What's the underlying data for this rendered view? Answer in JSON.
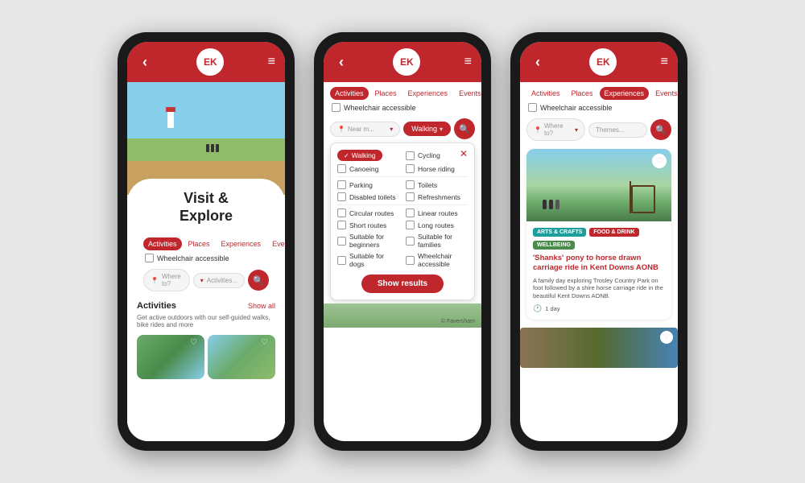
{
  "colors": {
    "primary": "#c0272d",
    "white": "#ffffff",
    "dark": "#1a1a1a",
    "gray": "#e8e8e8"
  },
  "phone1": {
    "header": {
      "logo": "EK",
      "back_icon": "‹",
      "menu_icon": "≡"
    },
    "nav_tabs": [
      {
        "label": "Activities",
        "active": true
      },
      {
        "label": "Places",
        "active": false
      },
      {
        "label": "Experiences",
        "active": false
      },
      {
        "label": "Events",
        "active": false
      }
    ],
    "wheelchair_label": "Wheelchair accessible",
    "search": {
      "placeholder": "Where to?",
      "dropdown_placeholder": "Activities..."
    },
    "hero_title": "Visit &\nExplore",
    "activities_section": {
      "title": "Activities",
      "show_all": "Show all",
      "description": "Get active outdoors with our self-guided walks, bike rides and more"
    }
  },
  "phone2": {
    "header": {
      "logo": "EK",
      "back_icon": "‹",
      "menu_icon": "≡"
    },
    "nav_tabs": [
      {
        "label": "Activities",
        "active": true
      },
      {
        "label": "Places",
        "active": false
      },
      {
        "label": "Experiences",
        "active": false
      },
      {
        "label": "Events",
        "active": false
      }
    ],
    "wheelchair_label": "Wheelchair accessible",
    "search": {
      "near_placeholder": "Near m...",
      "active_filter": "Walking"
    },
    "dropdown": {
      "filters": [
        {
          "label": "Walking",
          "checked": true
        },
        {
          "label": "Cycling",
          "checked": false
        },
        {
          "label": "Canoeing",
          "checked": false
        },
        {
          "label": "Horse riding",
          "checked": false
        }
      ],
      "amenities": [
        {
          "label": "Parking",
          "checked": false
        },
        {
          "label": "Toilets",
          "checked": false
        },
        {
          "label": "Disabled toilets",
          "checked": false
        },
        {
          "label": "Refreshments",
          "checked": false
        }
      ],
      "route_types": [
        {
          "label": "Circular routes",
          "checked": false
        },
        {
          "label": "Linear routes",
          "checked": false
        },
        {
          "label": "Short routes",
          "checked": false
        },
        {
          "label": "Long routes",
          "checked": false
        },
        {
          "label": "Suitable for beginners",
          "checked": false
        },
        {
          "label": "Suitable for families",
          "checked": false
        },
        {
          "label": "Suitable for dogs",
          "checked": false
        },
        {
          "label": "Wheelchair accessible",
          "checked": false
        }
      ],
      "show_results_label": "Show results"
    }
  },
  "phone3": {
    "header": {
      "logo": "EK",
      "back_icon": "‹",
      "menu_icon": "≡"
    },
    "nav_tabs": [
      {
        "label": "Activities",
        "active": false
      },
      {
        "label": "Places",
        "active": false
      },
      {
        "label": "Experiences",
        "active": true
      },
      {
        "label": "Events",
        "active": false
      }
    ],
    "wheelchair_label": "Wheelchair accessible",
    "search": {
      "where_placeholder": "Where to?",
      "themes_placeholder": "Themes..."
    },
    "result_card": {
      "tags": [
        "ARTS & CRAFTS",
        "FOOD & DRINK",
        "WELLBEING"
      ],
      "title": "'Shanks' pony to horse drawn carriage ride in Kent Downs AONB",
      "description": "A family day exploring Trosley Country Park on foot followed by a shire horse carriage ride in the beautiful Kent Downs AONB.",
      "duration": "1 day"
    }
  }
}
